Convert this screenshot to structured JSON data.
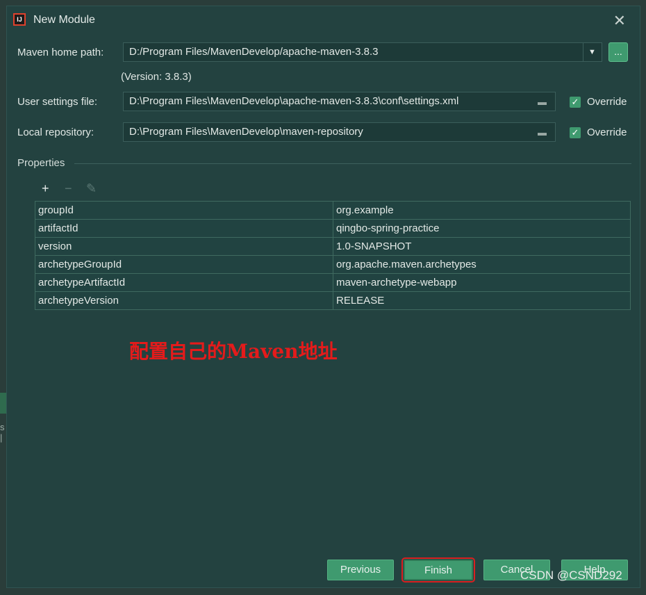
{
  "dialog": {
    "title": "New Module",
    "close_glyph": "✕"
  },
  "maven": {
    "home_label": "Maven home path:",
    "home_value": "D:/Program Files/MavenDevelop/apache-maven-3.8.3",
    "version_note": "(Version: 3.8.3)",
    "browse_label": "...",
    "settings_label": "User settings file:",
    "settings_value": "D:\\Program Files\\MavenDevelop\\apache-maven-3.8.3\\conf\\settings.xml",
    "repo_label": "Local repository:",
    "repo_value": "D:\\Program Files\\MavenDevelop\\maven-repository",
    "override_label": "Override",
    "override_settings_checked": true,
    "override_repo_checked": true
  },
  "properties": {
    "title": "Properties",
    "toolbar": {
      "add": "+",
      "remove": "−",
      "edit": "✎"
    },
    "rows": [
      {
        "key": "groupId",
        "value": "org.example"
      },
      {
        "key": "artifactId",
        "value": "qingbo-spring-practice"
      },
      {
        "key": "version",
        "value": "1.0-SNAPSHOT"
      },
      {
        "key": "archetypeGroupId",
        "value": "org.apache.maven.archetypes"
      },
      {
        "key": "archetypeArtifactId",
        "value": "maven-archetype-webapp"
      },
      {
        "key": "archetypeVersion",
        "value": "RELEASE"
      }
    ]
  },
  "annotation": "配置自己的Maven地址",
  "buttons": {
    "previous": "Previous",
    "finish": "Finish",
    "cancel": "Cancel",
    "help": "Help"
  },
  "watermark": "CSDN @CSND292",
  "colors": {
    "accent": "#3f9a6f",
    "background": "#234240",
    "annotation": "#e41b1b"
  },
  "icons": {
    "app": "intellij-icon",
    "folder": "folder-icon",
    "close": "close-icon",
    "dropdown": "chevron-down-icon"
  }
}
